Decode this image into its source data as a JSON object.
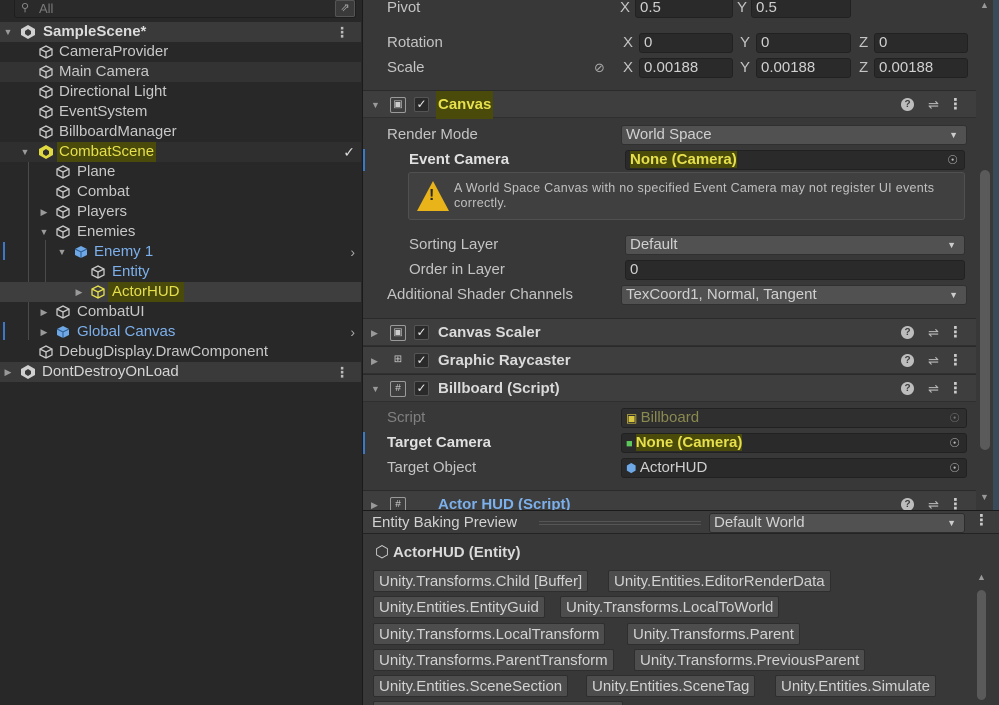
{
  "hierarchy": {
    "search_placeholder": "All",
    "items": [
      {
        "label": "SampleScene*",
        "type": "scene"
      },
      {
        "label": "CameraProvider"
      },
      {
        "label": "Main Camera"
      },
      {
        "label": "Directional Light"
      },
      {
        "label": "EventSystem"
      },
      {
        "label": "BillboardManager"
      },
      {
        "label": "CombatScene",
        "type": "subscene"
      },
      {
        "label": "Plane"
      },
      {
        "label": "Combat"
      },
      {
        "label": "Players"
      },
      {
        "label": "Enemies"
      },
      {
        "label": "Enemy 1",
        "type": "prefab"
      },
      {
        "label": "Entity"
      },
      {
        "label": "ActorHUD",
        "type": "selected"
      },
      {
        "label": "CombatUI"
      },
      {
        "label": "Global Canvas",
        "type": "prefab"
      },
      {
        "label": "DebugDisplay.DrawComponent"
      },
      {
        "label": "DontDestroyOnLoad",
        "type": "scene"
      }
    ]
  },
  "inspector": {
    "pivot": {
      "label": "Pivot",
      "x_axis": "X",
      "x": "0.5",
      "y_axis": "Y",
      "y": "0.5"
    },
    "rotation": {
      "label": "Rotation",
      "x_axis": "X",
      "x": "0",
      "y_axis": "Y",
      "y": "0",
      "z_axis": "Z",
      "z": "0"
    },
    "scale": {
      "label": "Scale",
      "x_axis": "X",
      "x": "0.00188",
      "y_axis": "Y",
      "y": "0.00188",
      "z_axis": "Z",
      "z": "0.00188"
    },
    "canvas": {
      "title": "Canvas",
      "render_mode_label": "Render Mode",
      "render_mode": "World Space",
      "event_camera_label": "Event Camera",
      "event_camera": "None (Camera)",
      "warning": "A World Space Canvas with no specified Event Camera may not register UI events correctly.",
      "sorting_layer_label": "Sorting Layer",
      "sorting_layer": "Default",
      "order_label": "Order in Layer",
      "order": "0",
      "shader_channels_label": "Additional Shader Channels",
      "shader_channels": "TexCoord1, Normal, Tangent"
    },
    "canvas_scaler": {
      "title": "Canvas Scaler"
    },
    "graphic_raycaster": {
      "title": "Graphic Raycaster"
    },
    "billboard": {
      "title": "Billboard (Script)",
      "script_label": "Script",
      "script": "Billboard",
      "target_camera_label": "Target Camera",
      "target_camera": "None (Camera)",
      "target_object_label": "Target Object",
      "target_object": "ActorHUD"
    },
    "actor_hud": {
      "title": "Actor HUD (Script)"
    }
  },
  "baking": {
    "title": "Entity Baking Preview",
    "world": "Default World",
    "entity": "ActorHUD (Entity)",
    "components": [
      "Unity.Transforms.Child [Buffer]",
      "Unity.Entities.EditorRenderData",
      "Unity.Entities.EntityGuid",
      "Unity.Transforms.LocalToWorld",
      "Unity.Transforms.LocalTransform",
      "Unity.Transforms.Parent",
      "Unity.Transforms.ParentTransform",
      "Unity.Transforms.PreviousParent",
      "Unity.Entities.SceneSection",
      "Unity.Entities.SceneTag",
      "Unity.Entities.Simulate"
    ]
  },
  "colors": {
    "accent": "#3b78c6",
    "highlight": "#e6e04c",
    "warning": "#e8b41a",
    "prefab": "#7cb0ec"
  }
}
